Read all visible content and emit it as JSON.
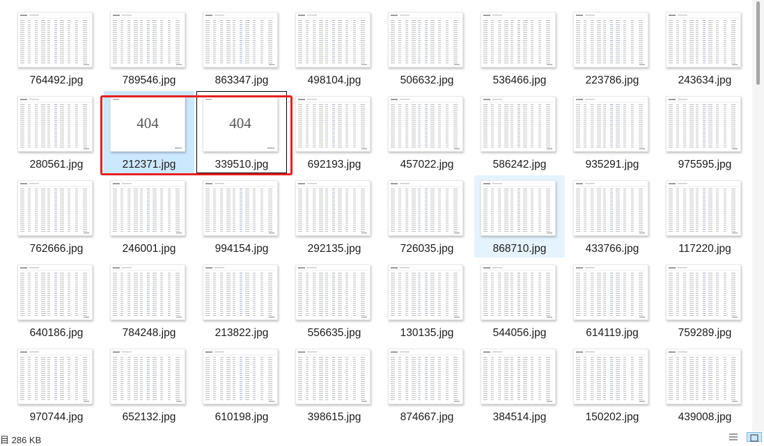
{
  "files": [
    {
      "name": "764492.jpg"
    },
    {
      "name": "789546.jpg"
    },
    {
      "name": "863347.jpg"
    },
    {
      "name": "498104.jpg"
    },
    {
      "name": "506632.jpg"
    },
    {
      "name": "536466.jpg"
    },
    {
      "name": "223786.jpg"
    },
    {
      "name": "243634.jpg"
    },
    {
      "name": "280561.jpg"
    },
    {
      "name": "212371.jpg",
      "state": "selected",
      "thumb_text": "404"
    },
    {
      "name": "339510.jpg",
      "state": "focused",
      "thumb_text": "404"
    },
    {
      "name": "692193.jpg"
    },
    {
      "name": "457022.jpg"
    },
    {
      "name": "586242.jpg"
    },
    {
      "name": "935291.jpg"
    },
    {
      "name": "975595.jpg"
    },
    {
      "name": "762666.jpg"
    },
    {
      "name": "246001.jpg"
    },
    {
      "name": "994154.jpg"
    },
    {
      "name": "292135.jpg"
    },
    {
      "name": "726035.jpg"
    },
    {
      "name": "868710.jpg",
      "state": "hover"
    },
    {
      "name": "433766.jpg"
    },
    {
      "name": "117220.jpg"
    },
    {
      "name": "640186.jpg"
    },
    {
      "name": "784248.jpg"
    },
    {
      "name": "213822.jpg"
    },
    {
      "name": "556635.jpg"
    },
    {
      "name": "130135.jpg"
    },
    {
      "name": "544056.jpg"
    },
    {
      "name": "614119.jpg"
    },
    {
      "name": "759289.jpg"
    },
    {
      "name": "970744.jpg"
    },
    {
      "name": "652132.jpg"
    },
    {
      "name": "610198.jpg"
    },
    {
      "name": "398615.jpg"
    },
    {
      "name": "874667.jpg"
    },
    {
      "name": "384514.jpg"
    },
    {
      "name": "150202.jpg"
    },
    {
      "name": "439008.jpg"
    }
  ],
  "status_bar": {
    "text": "目 286 KB"
  },
  "view_buttons": {
    "details": "details-view-icon",
    "large_icons": "large-icons-view-icon"
  },
  "colors": {
    "selection": "#cce8ff",
    "hover": "#e5f3ff",
    "annotation": "#e81e1e"
  }
}
